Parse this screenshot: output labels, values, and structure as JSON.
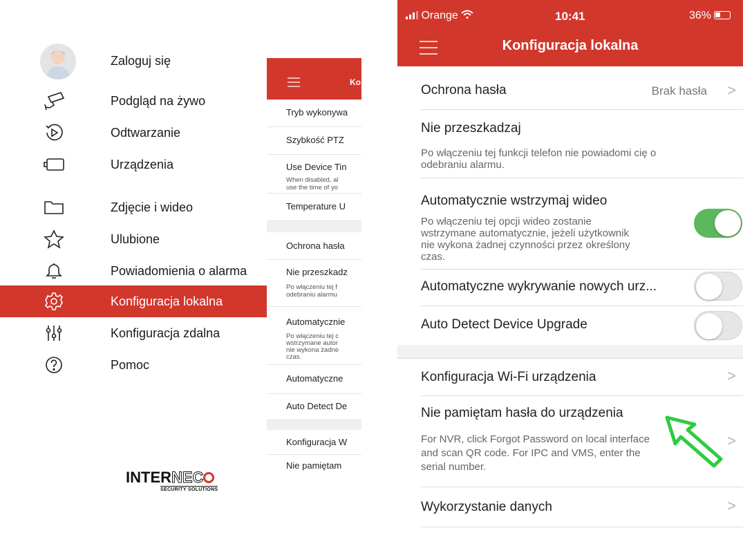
{
  "left_menu": {
    "items": [
      {
        "label": "Zaloguj się",
        "icon": "user-avatar"
      },
      {
        "label": "Podgląd na żywo",
        "icon": "camera-icon"
      },
      {
        "label": "Odtwarzanie",
        "icon": "playback-icon"
      },
      {
        "label": "Urządzenia",
        "icon": "device-icon"
      },
      {
        "label": "Zdjęcie i wideo",
        "icon": "folder-icon"
      },
      {
        "label": "Ulubione",
        "icon": "star-icon"
      },
      {
        "label": "Powiadomienia o alarma",
        "icon": "bell-icon"
      },
      {
        "label": "Konfiguracja lokalna",
        "icon": "gear-icon",
        "active": true
      },
      {
        "label": "Konfiguracja zdalna",
        "icon": "sliders-icon"
      },
      {
        "label": "Pomoc",
        "icon": "help-icon"
      }
    ],
    "logo": {
      "text_left": "INTER",
      "text_outline": "NEC",
      "subtitle": "SECURITY SOLUTIONS"
    }
  },
  "middle": {
    "header_title": "Ko",
    "rows": [
      {
        "title": "Tryb wykonywa"
      },
      {
        "title": "Szybkość PTZ"
      },
      {
        "title": "Use Device Tin",
        "desc1": "When disabled, al",
        "desc2": "use the time of yo"
      },
      {
        "title": "Temperature U"
      },
      {
        "title": "Ochrona hasła"
      },
      {
        "title": "Nie przeszkadz",
        "desc1": "Po włączeniu tej f",
        "desc2": "odebraniu alarmu"
      },
      {
        "title": "Automatycznie",
        "desc1": "Po włączeniu tej c",
        "desc2": "wstrzymane autor",
        "desc3": "nie wykona żadne",
        "desc4": "czas."
      },
      {
        "title": "Automatyczne"
      },
      {
        "title": "Auto Detect De"
      },
      {
        "title": "Konfiguracja W"
      },
      {
        "title": "Nie pamiętam"
      }
    ]
  },
  "phone": {
    "status": {
      "carrier": "Orange",
      "time": "10:41",
      "battery": "36%"
    },
    "title": "Konfiguracja lokalna",
    "rows": {
      "password": {
        "title": "Ochrona hasła",
        "value": "Brak hasła",
        "chevron": ">"
      },
      "dnd": {
        "title": "Nie przeszkadzaj",
        "desc_line1": "Po włączeniu tej funkcji telefon nie powiadomi cię o",
        "desc_line2": "odebraniu alarmu."
      },
      "auto_pause": {
        "title": "Automatycznie wstrzymaj wideo",
        "desc_line1": "Po włączeniu tej opcji wideo zostanie",
        "desc_line2": "wstrzymane automatycznie, jeżeli użytkownik",
        "desc_line3": "nie wykona żadnej czynności przez określony",
        "desc_line4": "czas.",
        "toggle": true
      },
      "auto_detect_new": {
        "title": "Automatyczne wykrywanie nowych urz...",
        "toggle": false
      },
      "auto_upgrade": {
        "title": "Auto Detect Device Upgrade",
        "toggle": false
      },
      "wifi": {
        "title": "Konfiguracja Wi-Fi urządzenia",
        "chevron": ">"
      },
      "forgot": {
        "title": "Nie pamiętam hasła do urządzenia",
        "desc_line1": "For NVR, click Forgot Password on local interface",
        "desc_line2": "and scan QR code. For IPC and VMS, enter the",
        "desc_line3": "serial number.",
        "chevron": ">"
      },
      "data_usage": {
        "title": "Wykorzystanie danych",
        "chevron": ">"
      }
    }
  },
  "colors": {
    "brand_red": "#d2372c",
    "toggle_green": "#5cb85c",
    "annotation_arrow": "#2ecc40"
  }
}
